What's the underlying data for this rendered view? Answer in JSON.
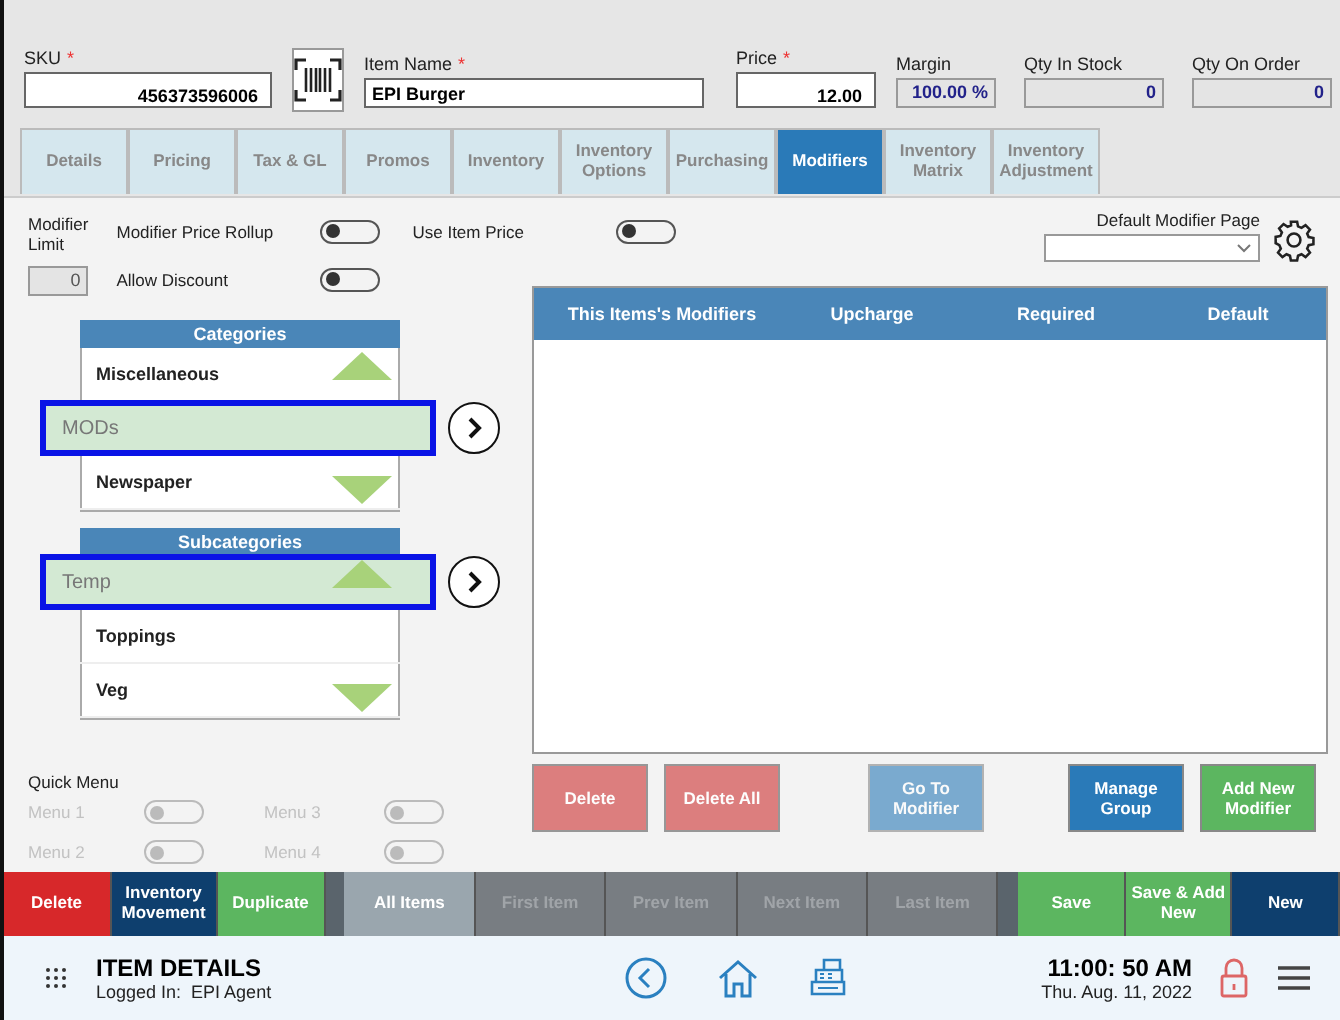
{
  "header": {
    "sku": {
      "label": "SKU",
      "required_mark": "*",
      "value": "456373596006"
    },
    "item_name": {
      "label": "Item Name",
      "required_mark": "*",
      "value": "EPI Burger"
    },
    "price": {
      "label": "Price",
      "required_mark": "*",
      "value": "12.00"
    },
    "margin": {
      "label": "Margin",
      "value": "100.00 %"
    },
    "qty_in_stock": {
      "label": "Qty In Stock",
      "value": "0"
    },
    "qty_on_order": {
      "label": "Qty On Order",
      "value": "0"
    }
  },
  "tabs": [
    {
      "label": "Details",
      "selected": false
    },
    {
      "label": "Pricing",
      "selected": false
    },
    {
      "label": "Tax & GL",
      "selected": false
    },
    {
      "label": "Promos",
      "selected": false
    },
    {
      "label": "Inventory",
      "selected": false
    },
    {
      "label": "Inventory Options",
      "selected": false
    },
    {
      "label": "Purchasing",
      "selected": false
    },
    {
      "label": "Modifiers",
      "selected": true
    },
    {
      "label": "Inventory Matrix",
      "selected": false
    },
    {
      "label": "Inventory Adjustment",
      "selected": false
    }
  ],
  "modifier_limit": {
    "label": "Modifier Limit",
    "value": "0"
  },
  "toggles": [
    {
      "label": "Modifier Price Rollup",
      "on": false
    },
    {
      "label": "Use Item Price",
      "on": false
    },
    {
      "label": "Allow Discount",
      "on": false
    }
  ],
  "default_modifier_page": {
    "label": "Default Modifier Page"
  },
  "categories": {
    "title": "Categories",
    "items": [
      {
        "label": "Miscellaneous",
        "selected": false
      },
      {
        "label": "MODs",
        "selected": true
      },
      {
        "label": "Newspaper",
        "selected": false
      }
    ]
  },
  "subcategories": {
    "title": "Subcategories",
    "items": [
      {
        "label": "Temp",
        "selected": true
      },
      {
        "label": "Toppings",
        "selected": false
      },
      {
        "label": "Veg",
        "selected": false
      }
    ]
  },
  "quick_menu": {
    "title": "Quick Menu",
    "items": [
      {
        "label": "Menu 1",
        "on": false,
        "disabled": true
      },
      {
        "label": "Menu 3",
        "on": false,
        "disabled": true
      },
      {
        "label": "Menu 2",
        "on": false,
        "disabled": true
      },
      {
        "label": "Menu 4",
        "on": false,
        "disabled": true
      }
    ]
  },
  "modifiers_table": {
    "columns": [
      "This Items's Modifiers",
      "Upcharge",
      "Required",
      "Default"
    ]
  },
  "table_buttons": [
    {
      "label": "Delete",
      "kind": "danger",
      "disabled": true
    },
    {
      "label": "Delete All",
      "kind": "danger",
      "disabled": true
    },
    {
      "label": "Go To Modifier",
      "kind": "info",
      "disabled": true
    },
    {
      "label": "Manage Group",
      "kind": "primary",
      "disabled": false
    },
    {
      "label": "Add New Modifier",
      "kind": "success",
      "disabled": false
    }
  ],
  "action_bar": [
    {
      "label": "Delete",
      "kind": "danger",
      "disabled": false
    },
    {
      "label": "Inventory Movement",
      "kind": "navy",
      "disabled": false
    },
    {
      "label": "Duplicate",
      "kind": "success",
      "disabled": false
    },
    {
      "label": "All Items",
      "kind": "slate",
      "disabled": false
    },
    {
      "label": "First Item",
      "kind": "gray",
      "disabled": true
    },
    {
      "label": "Prev Item",
      "kind": "gray",
      "disabled": true
    },
    {
      "label": "Next Item",
      "kind": "gray",
      "disabled": true
    },
    {
      "label": "Last Item",
      "kind": "gray",
      "disabled": true
    },
    {
      "label": "Save",
      "kind": "success",
      "disabled": false
    },
    {
      "label": "Save & Add New",
      "kind": "success",
      "disabled": false
    },
    {
      "label": "New",
      "kind": "navy",
      "disabled": false
    }
  ],
  "footer": {
    "title": "ITEM DETAILS",
    "logged_in_label": "Logged In:",
    "user": "EPI Agent",
    "time": "11:00: 50 AM",
    "date": "Thu. Aug. 11, 2022"
  }
}
